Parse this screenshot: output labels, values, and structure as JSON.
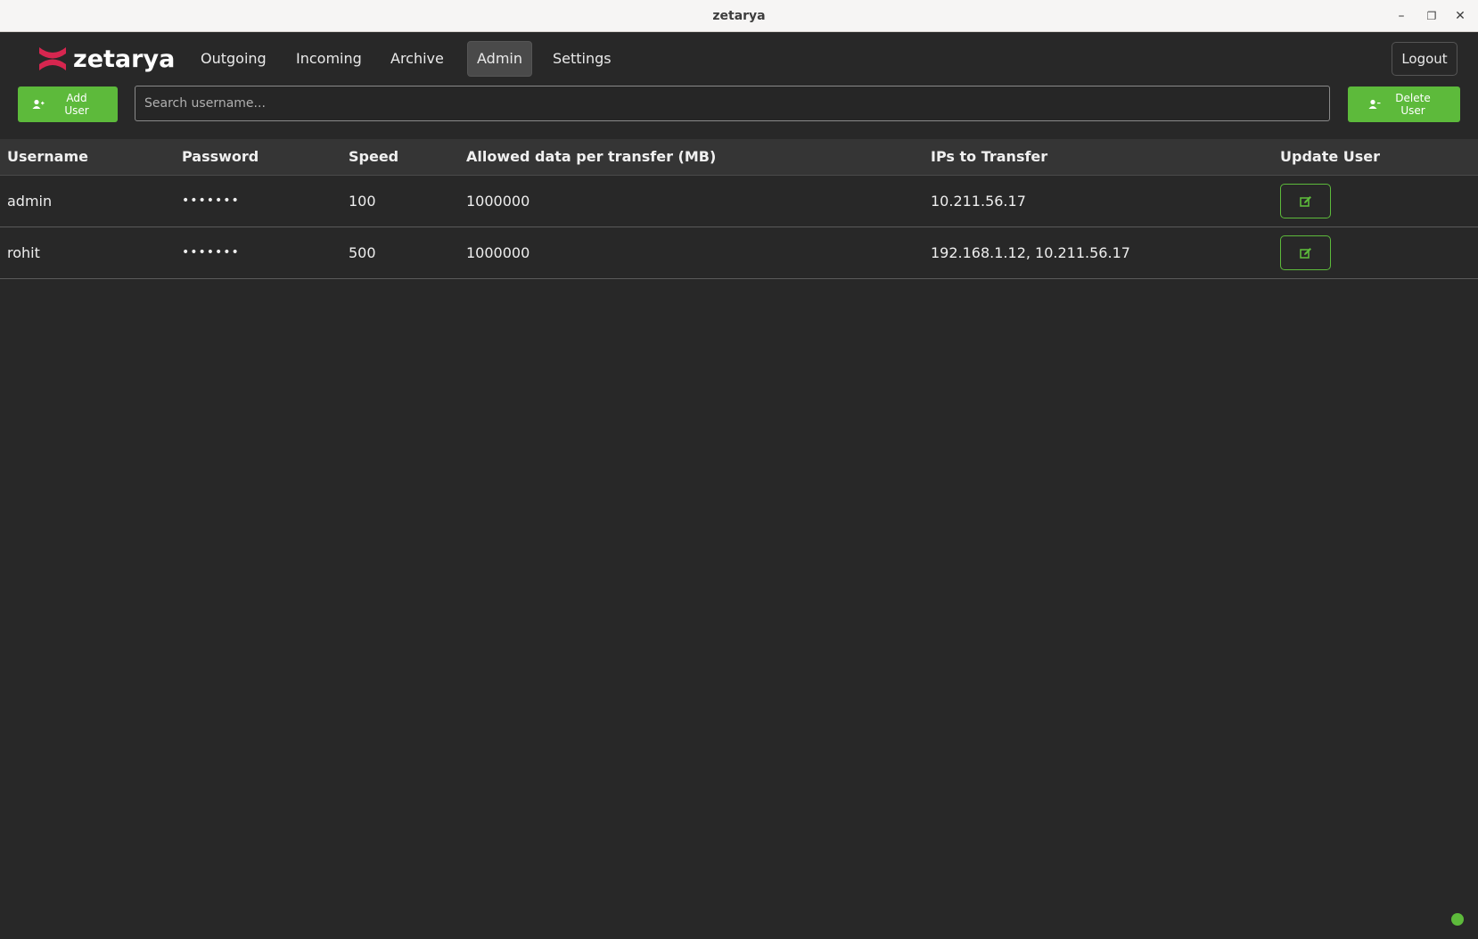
{
  "window": {
    "title": "zetarya"
  },
  "brand": {
    "name": "zetarya",
    "logo_color": "#d6264f"
  },
  "nav": {
    "items": [
      {
        "label": "Outgoing",
        "active": false
      },
      {
        "label": "Incoming",
        "active": false
      },
      {
        "label": "Archive",
        "active": false
      },
      {
        "label": "Admin",
        "active": true
      },
      {
        "label": "Settings",
        "active": false
      }
    ],
    "logout_label": "Logout"
  },
  "toolbar": {
    "add_user_label_1": "Add",
    "add_user_label_2": "User",
    "delete_user_label_1": "Delete",
    "delete_user_label_2": "User",
    "search_placeholder": "Search username...",
    "search_value": ""
  },
  "table": {
    "headers": [
      "Username",
      "Password",
      "Speed",
      "Allowed data per transfer (MB)",
      "IPs to Transfer",
      "Update User"
    ],
    "rows": [
      {
        "username": "admin",
        "password": "•••••••",
        "speed": "100",
        "allowed": "1000000",
        "ips": "10.211.56.17"
      },
      {
        "username": "rohit",
        "password": "•••••••",
        "speed": "500",
        "allowed": "1000000",
        "ips": "192.168.1.12, 10.211.56.17"
      }
    ]
  },
  "colors": {
    "accent": "#5dba3b",
    "background": "#282828",
    "header": "#353535"
  },
  "icons": {
    "add_user": "user-plus-icon",
    "delete_user": "user-minus-icon",
    "edit": "edit-icon",
    "status": "status-dot"
  }
}
